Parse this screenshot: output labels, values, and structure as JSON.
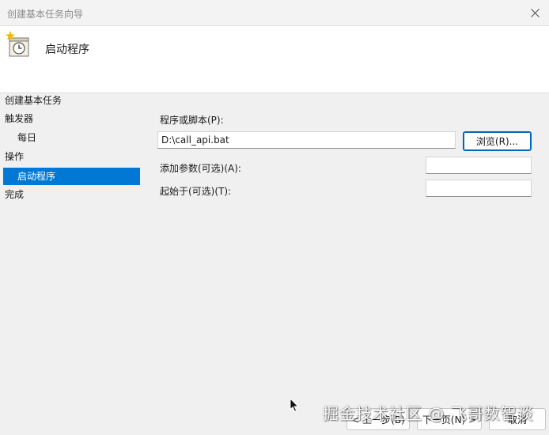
{
  "window": {
    "title": "创建基本任务向导",
    "close_icon": "close-icon"
  },
  "header": {
    "icon": "scheduled-task-icon",
    "title": "启动程序"
  },
  "sidebar": {
    "items": [
      {
        "label": "创建基本任务"
      },
      {
        "label": "触发器"
      },
      {
        "label": "每日"
      },
      {
        "label": "操作"
      },
      {
        "label": "启动程序"
      },
      {
        "label": "完成"
      }
    ],
    "active_color": "#0078d4"
  },
  "form": {
    "program_label": "程序或脚本(P):",
    "program_value": "D:\\call_api.bat",
    "browse_label": "浏览(R)...",
    "arguments_label": "添加参数(可选)(A):",
    "arguments_value": "",
    "start_in_label": "起始于(可选)(T):",
    "start_in_value": ""
  },
  "footer": {
    "back_label": "< 上一步(B)",
    "next_label": "下一页(N) >",
    "cancel_label": "取消"
  },
  "watermark": {
    "text": "掘金技术社区 @ 飞哥数智谈"
  }
}
